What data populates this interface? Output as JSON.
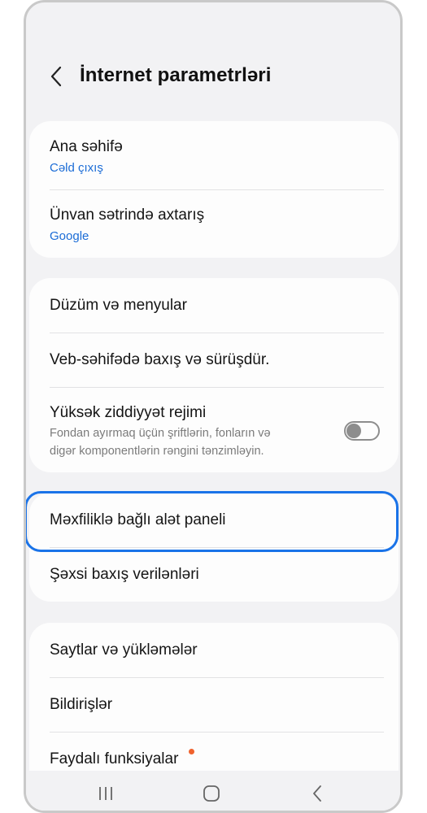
{
  "header": {
    "title": "İnternet parametrləri"
  },
  "group1": {
    "items": [
      {
        "label": "Ana səhifə",
        "sub": "Cəld çıxış"
      },
      {
        "label": "Ünvan sətrində axtarış",
        "sub": "Google"
      }
    ]
  },
  "group2": {
    "items": [
      {
        "label": "Düzüm və menyular"
      },
      {
        "label": "Veb-səhifədə baxış və sürüşdür."
      },
      {
        "label": "Yüksək ziddiyyət rejimi",
        "desc": "Fondan ayırmaq üçün şriftlərin, fonların və digər komponentlərin rəngini tənzimləyin.",
        "toggle_on": false
      }
    ]
  },
  "group3": {
    "items": [
      {
        "label": "Məxfiliklə bağlı alət paneli"
      },
      {
        "label": "Şəxsi baxış verilənləri"
      }
    ]
  },
  "group4": {
    "items": [
      {
        "label": "Saytlar və yükləmələr"
      },
      {
        "label": "Bildirişlər"
      },
      {
        "label": "Faydalı funksiyalar",
        "badge": "new-dot"
      }
    ]
  },
  "colors": {
    "accent": "#1a73e8",
    "subtext_blue": "#1b6cd6",
    "badge_dot": "#f0622d",
    "background": "#f2f2f4",
    "card": "#fdfdfd"
  },
  "icons": {
    "back": "chevron-left-icon",
    "nav_recents": "recents-icon",
    "nav_home": "home-icon",
    "nav_back": "back-icon"
  }
}
